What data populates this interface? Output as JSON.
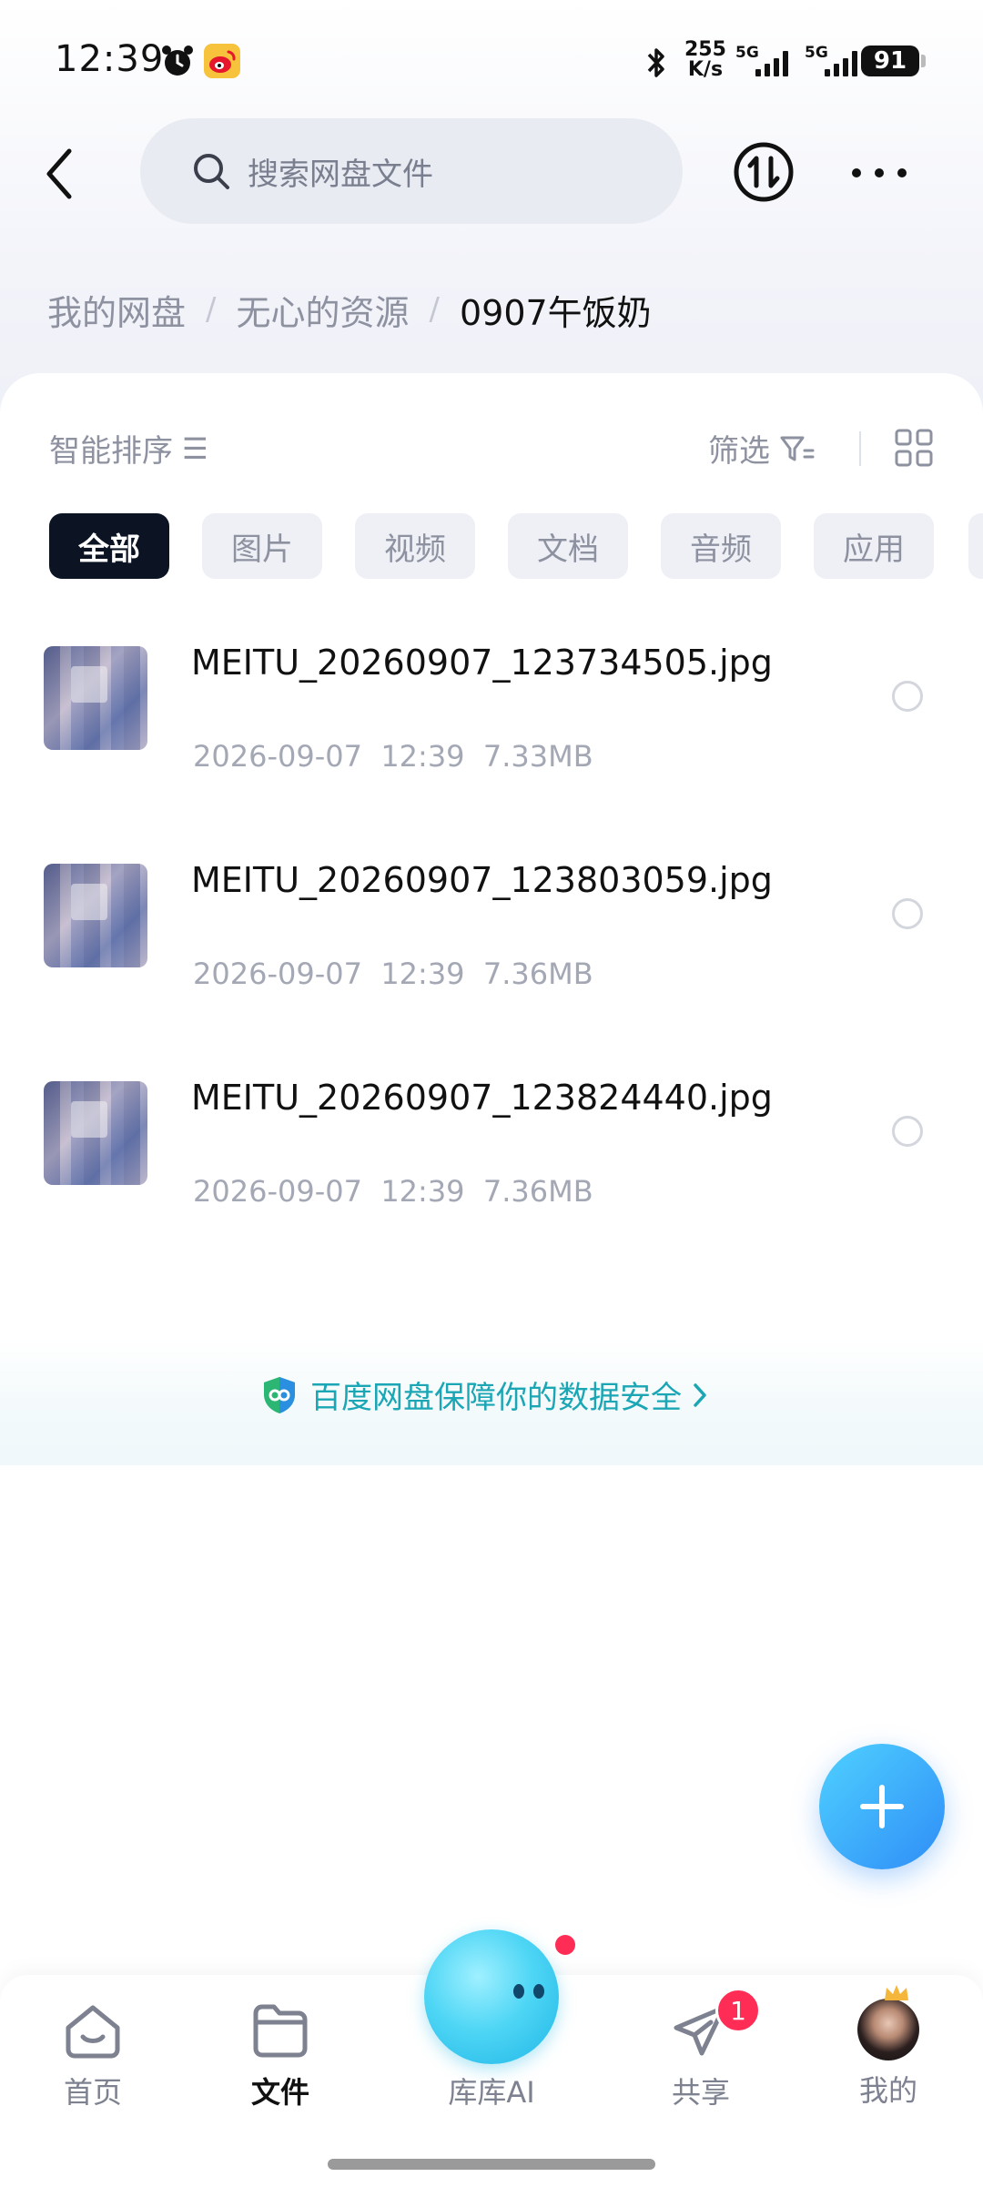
{
  "status_bar": {
    "time": "12:39",
    "net_speed_value": "255",
    "net_speed_unit": "K/s",
    "signal1": "5G",
    "signal2": "5G",
    "battery": "91"
  },
  "header": {
    "search_placeholder": "搜索网盘文件"
  },
  "breadcrumb": {
    "items": [
      "我的网盘",
      "无心的资源"
    ],
    "separator": "/",
    "current": "0907午饭奶"
  },
  "toolbar": {
    "sort_label": "智能排序",
    "sort_icon_glyph": "☰",
    "filter_label": "筛选"
  },
  "tabs": [
    "全部",
    "图片",
    "视频",
    "文档",
    "音频",
    "应用"
  ],
  "files": [
    {
      "name": "MEITU_20260907_123734505.jpg",
      "meta": "2026-09-07  12:39  7.33MB"
    },
    {
      "name": "MEITU_20260907_123803059.jpg",
      "meta": "2026-09-07  12:39  7.36MB"
    },
    {
      "name": "MEITU_20260907_123824440.jpg",
      "meta": "2026-09-07  12:39  7.36MB"
    }
  ],
  "security_banner": {
    "text": "百度网盘保障你的数据安全"
  },
  "bottom_nav": {
    "home": "首页",
    "files": "文件",
    "ai": "库库AI",
    "share": "共享",
    "share_badge": "1",
    "me": "我的"
  },
  "colors": {
    "accent": "#2f8df7",
    "security_text": "#1aa6b5",
    "badge": "#ff2d55",
    "active_tab": "#0c1424"
  }
}
